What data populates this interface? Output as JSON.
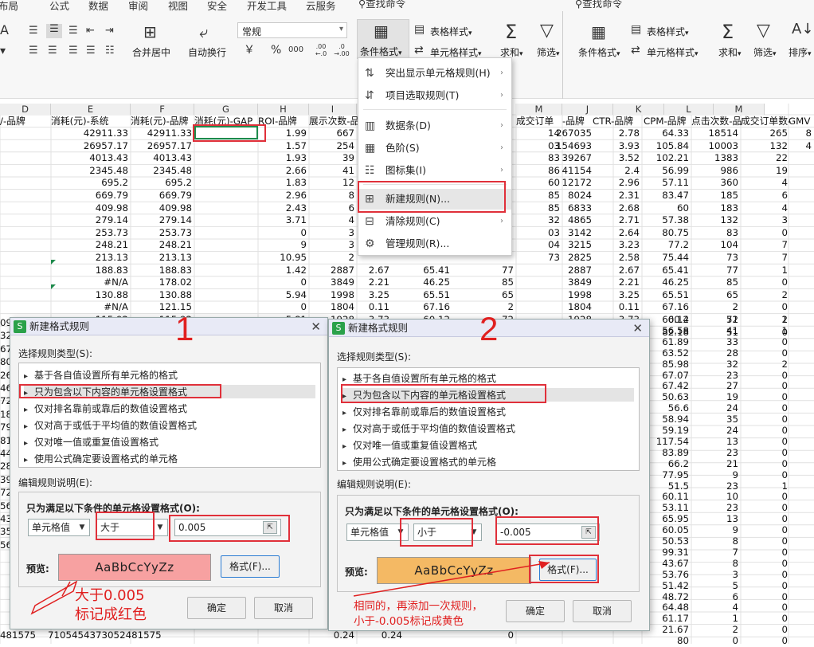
{
  "ribbon": {
    "menu_tabs": [
      "布局",
      "公式",
      "数据",
      "审阅",
      "视图",
      "安全",
      "开发工具",
      "云服务"
    ],
    "search_placeholder": "查找命令",
    "search_placeholder_right": "查找命令",
    "number_format": "常规",
    "merge_label": "合并居中",
    "wrap_label": "自动换行",
    "table_style_label": "表格样式",
    "cell_style_label": "单元格样式",
    "cond_format_label": "条件格式",
    "sum_label": "求和",
    "filter_label": "筛选",
    "sort_label": "排序",
    "currency_symbol": "￥",
    "percent_symbol": "%",
    "thousands_symbol": "000",
    "inc_decimal": ".00 ←.0",
    "dec_decimal": ".0 →.00"
  },
  "columns_left": [
    "D",
    "E",
    "F",
    "G",
    "H",
    "I"
  ],
  "columns_right": [
    "M",
    "J",
    "K",
    "L",
    "M"
  ],
  "header_row_left": [
    "/-品牌",
    "消耗(元)-系统",
    "消耗(元)-品牌",
    "消耗(元)-GAP",
    "ROI-品牌",
    "展示次数-品"
  ],
  "header_row_mid": "成交订单",
  "header_row_right": [
    "-品牌",
    "CTR-品牌",
    "CPM-品牌",
    "点击次数-品",
    "成交订单数-",
    "GMV"
  ],
  "rows_left": [
    [
      "42911.33",
      "42911.33",
      "",
      "1.99",
      "667"
    ],
    [
      "26957.17",
      "26957.17",
      "",
      "1.57",
      "254"
    ],
    [
      "4013.43",
      "4013.43",
      "",
      "1.93",
      "39"
    ],
    [
      "2345.48",
      "2345.48",
      "",
      "2.66",
      "41"
    ],
    [
      "695.2",
      "695.2",
      "",
      "1.83",
      "12"
    ],
    [
      "669.79",
      "669.79",
      "",
      "2.96",
      "8"
    ],
    [
      "409.98",
      "409.98",
      "",
      "2.43",
      "6"
    ],
    [
      "279.14",
      "279.14",
      "",
      "3.71",
      "4"
    ],
    [
      "253.73",
      "253.73",
      "",
      "0",
      "3"
    ],
    [
      "248.21",
      "248.21",
      "",
      "9",
      "3"
    ],
    [
      "213.13",
      "213.13",
      "",
      "10.95",
      "2"
    ],
    [
      "188.83",
      "188.83",
      "",
      "1.42",
      "2887"
    ],
    [
      "#N/A",
      "178.02",
      "",
      "0",
      "3849"
    ],
    [
      "130.88",
      "130.88",
      "",
      "5.94",
      "1998"
    ],
    [
      "#N/A",
      "121.15",
      "",
      "0",
      "1804"
    ],
    [
      "115.92",
      "115.92",
      "",
      "5.81",
      "1928"
    ],
    [
      "113.66",
      "113.66",
      "",
      "0",
      "1383"
    ]
  ],
  "rows_left_extra": [
    [
      "",
      "",
      "",
      "",
      "",
      "2.67",
      "65.41",
      "77"
    ],
    [
      "",
      "",
      "",
      "",
      "",
      "2.21",
      "46.25",
      "85"
    ],
    [
      "",
      "",
      "",
      "",
      "",
      "3.25",
      "65.51",
      "65"
    ],
    [
      "",
      "",
      "",
      "",
      "",
      "0.11",
      "67.16",
      "2"
    ],
    [
      "",
      "",
      "",
      "",
      "",
      "3.73",
      "60.12",
      "72"
    ],
    [
      "",
      "",
      "",
      "",
      "",
      "3.69",
      "82.18",
      "51"
    ]
  ],
  "rows_mid_m": [
    "14",
    "03",
    "83",
    "86",
    "60",
    "85",
    "85",
    "32",
    "03",
    "04",
    "73"
  ],
  "rows_mid_m2": [
    "2",
    "15"
  ],
  "rows_right": [
    [
      "267035",
      "2.78",
      "64.33",
      "18514",
      "265",
      "8"
    ],
    [
      "154693",
      "3.93",
      "105.84",
      "10003",
      "132",
      "4"
    ],
    [
      "39267",
      "3.52",
      "102.21",
      "1383",
      "22",
      ""
    ],
    [
      "41154",
      "2.4",
      "56.99",
      "986",
      "19",
      ""
    ],
    [
      "12172",
      "2.96",
      "57.11",
      "360",
      "4",
      ""
    ],
    [
      "8024",
      "2.31",
      "83.47",
      "185",
      "6",
      ""
    ],
    [
      "6833",
      "2.68",
      "60",
      "183",
      "4",
      ""
    ],
    [
      "4865",
      "2.71",
      "57.38",
      "132",
      "3",
      ""
    ],
    [
      "3142",
      "2.64",
      "80.75",
      "83",
      "0",
      ""
    ],
    [
      "3215",
      "3.23",
      "77.2",
      "104",
      "7",
      ""
    ],
    [
      "2825",
      "2.58",
      "75.44",
      "73",
      "7",
      ""
    ],
    [
      "2887",
      "2.67",
      "65.41",
      "77",
      "1",
      ""
    ],
    [
      "3849",
      "2.21",
      "46.25",
      "85",
      "0",
      ""
    ],
    [
      "1998",
      "3.25",
      "65.51",
      "65",
      "2",
      ""
    ],
    [
      "1804",
      "0.11",
      "67.16",
      "2",
      "0",
      ""
    ],
    [
      "1928",
      "3.73",
      "60.12",
      "72",
      "2",
      ""
    ],
    [
      "1383",
      "3.69",
      "82.18",
      "51",
      "0",
      ""
    ]
  ],
  "rows_right_lower": [
    [
      "60.4",
      "51",
      "1"
    ],
    [
      "56.58",
      "41",
      "1"
    ],
    [
      "61.89",
      "33",
      "0"
    ],
    [
      "63.52",
      "28",
      "0"
    ],
    [
      "85.98",
      "32",
      "2"
    ],
    [
      "67.07",
      "23",
      "0"
    ],
    [
      "67.42",
      "27",
      "0"
    ],
    [
      "50.63",
      "19",
      "0"
    ],
    [
      "56.6",
      "24",
      "0"
    ],
    [
      "58.94",
      "35",
      "0"
    ],
    [
      "59.19",
      "24",
      "0"
    ],
    [
      "117.54",
      "13",
      "0"
    ],
    [
      "83.89",
      "23",
      "0"
    ],
    [
      "66.2",
      "21",
      "0"
    ],
    [
      "77.95",
      "9",
      "0"
    ],
    [
      "51.5",
      "23",
      "1"
    ],
    [
      "60.11",
      "10",
      "0"
    ],
    [
      "53.11",
      "23",
      "0"
    ],
    [
      "65.95",
      "13",
      "0"
    ],
    [
      "60.05",
      "9",
      "0"
    ],
    [
      "50.53",
      "8",
      "0"
    ],
    [
      "99.31",
      "7",
      "0"
    ],
    [
      "43.67",
      "8",
      "0"
    ],
    [
      "53.76",
      "3",
      "0"
    ],
    [
      "51.42",
      "5",
      "0"
    ],
    [
      "48.72",
      "6",
      "0"
    ],
    [
      "64.48",
      "4",
      "0"
    ],
    [
      "61.17",
      "1",
      "0"
    ],
    [
      "21.67",
      "2",
      "0"
    ],
    [
      "80",
      "0",
      "0"
    ]
  ],
  "left_row_stubs": [
    "09",
    "32",
    "67",
    "80",
    "26",
    "46",
    "72",
    "18",
    "79",
    "81",
    "44",
    "28",
    "39",
    "72",
    "56",
    "43",
    "35",
    "56"
  ],
  "bottom_row": {
    "a": "10",
    "b": "2.45",
    "c": "9",
    "d": "1",
    "e": "0",
    "stub": "481575",
    "tail": "710545437305",
    "tail2": "2481575",
    "v1": "0.24",
    "v2": "0.24",
    "v3": "0",
    "v4": "0",
    "v5": "2"
  },
  "lower_stubs": [
    "35",
    "99",
    "20",
    "09"
  ],
  "cond_menu": {
    "items": [
      "突出显示单元格规则(H)",
      "项目选取规则(T)",
      "数据条(D)",
      "色阶(S)",
      "图标集(I)",
      "新建规则(N)...",
      "清除规则(C)",
      "管理规则(R)..."
    ]
  },
  "dialog1": {
    "number": "1",
    "title": "新建格式规则",
    "rule_type_label": "选择规则类型(S):",
    "rule_types": [
      "基于各自值设置所有单元格的格式",
      "只为包含以下内容的单元格设置格式",
      "仅对排名靠前或靠后的数值设置格式",
      "仅对高于或低于平均值的数值设置格式",
      "仅对唯一值或重复值设置格式",
      "使用公式确定要设置格式的单元格"
    ],
    "desc_label": "编辑规则说明(E):",
    "cond_title": "只为满足以下条件的单元格设置格式(O):",
    "sel1": "单元格值",
    "sel2": "大于",
    "value": "0.005",
    "preview_label": "预览:",
    "preview_text": "AaBbCcYyZz",
    "preview_color": "#f7a1a1",
    "format_btn": "格式(F)...",
    "ok": "确定",
    "cancel": "取消"
  },
  "dialog2": {
    "number": "2",
    "title": "新建格式规则",
    "rule_type_label": "选择规则类型(S):",
    "rule_types": [
      "基于各自值设置所有单元格的格式",
      "只为包含以下内容的单元格设置格式",
      "仅对排名靠前或靠后的数值设置格式",
      "仅对高于或低于平均值的数值设置格式",
      "仅对唯一值或重复值设置格式",
      "使用公式确定要设置格式的单元格"
    ],
    "desc_label": "编辑规则说明(E):",
    "cond_title": "只为满足以下条件的单元格设置格式(O):",
    "sel1": "单元格值",
    "sel2": "小于",
    "value": "-0.005",
    "preview_label": "预览:",
    "preview_text": "AaBbCcYyZz",
    "preview_color": "#f4b964",
    "format_btn": "格式(F)...",
    "ok": "确定",
    "cancel": "取消"
  },
  "annotation1": {
    "line1": "大于0.005",
    "line2": "标记成红色"
  },
  "annotation2": {
    "line1": "相同的，再添加一次规则，",
    "line2": "小于-0.005标记成黄色"
  },
  "colors": {
    "accent_red": "#e02020",
    "selection_green": "#1e8a4c",
    "dialog_title_bg": "#e8eaf6"
  }
}
